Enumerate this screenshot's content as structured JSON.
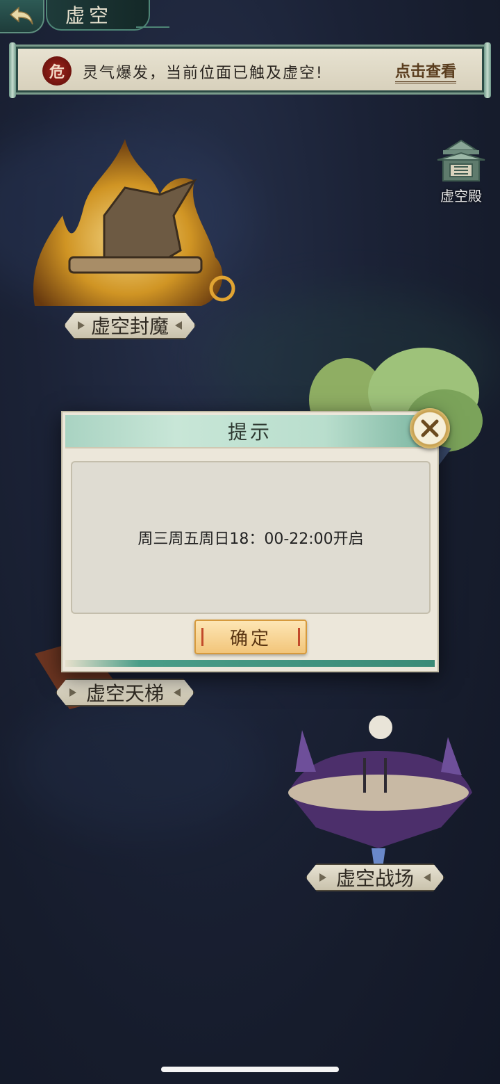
{
  "header": {
    "title": "虚空",
    "back_icon": "back-arrow-icon"
  },
  "banner": {
    "seal_text": "危",
    "message": "灵气爆发，当前位面已触及虚空!",
    "link_label": "点击查看"
  },
  "palace": {
    "label": "虚空殿",
    "icon": "palace-icon"
  },
  "map": {
    "nodes": [
      {
        "label": "虚空封魔"
      },
      {
        "label": "虚空天梯"
      },
      {
        "label": "虚空战场"
      }
    ]
  },
  "dialog": {
    "title": "提示",
    "message": "周三周五周日18：00-22:00开启",
    "confirm_label": "确定",
    "close_icon": "close-icon"
  },
  "colors": {
    "accent_green": "#4a9d88",
    "confirm_gold": "#f2c57a",
    "danger_red": "#a1241d"
  }
}
